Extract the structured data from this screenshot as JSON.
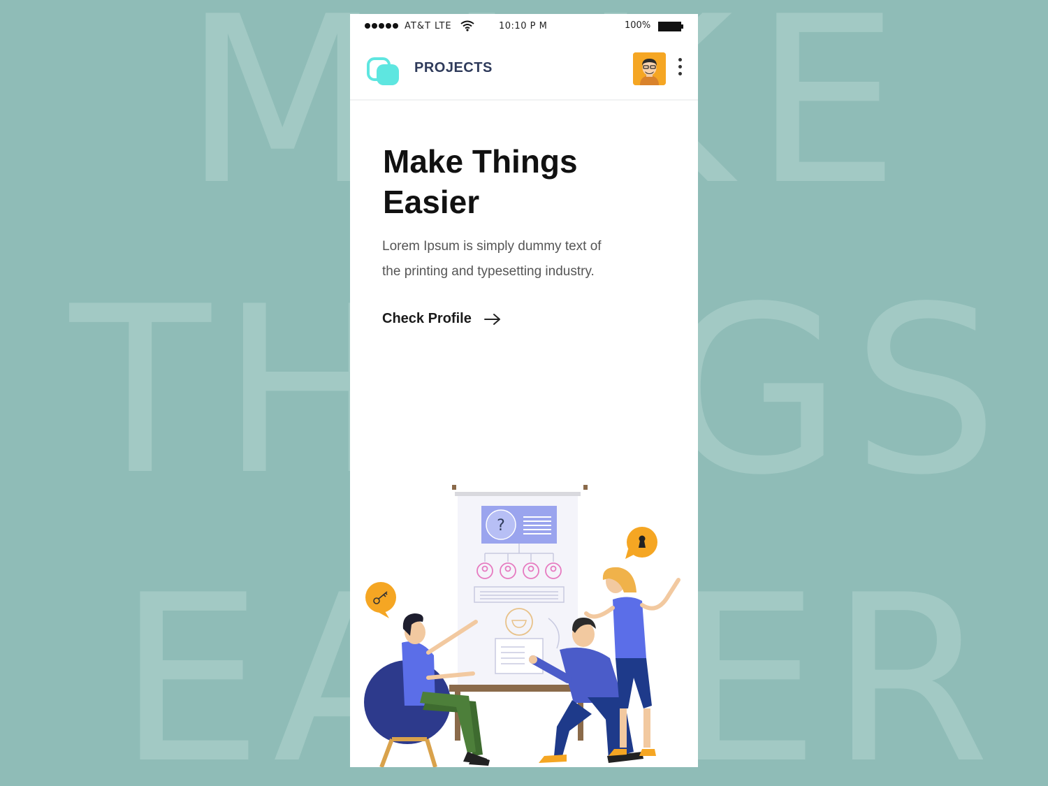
{
  "background": {
    "words": [
      "MAKE",
      "THINGS",
      "EASIER"
    ]
  },
  "status_bar": {
    "carrier": "AT&T  LTE",
    "time": "10:10 P    M",
    "battery": "100%"
  },
  "header": {
    "title": "PROJECTS"
  },
  "hero": {
    "title_line1": "Make Things",
    "title_line2": "Easier",
    "text_line1": "Lorem Ipsum is simply dummy text of",
    "text_line2": "the printing and typesetting industry.",
    "cta_label": "Check Profile"
  },
  "colors": {
    "background": "#8fbcb7",
    "accent_teal": "#5ee6e0",
    "accent_orange": "#f5a623",
    "accent_blue": "#5b6ee8",
    "text_dark": "#111111"
  },
  "icons": [
    "signal-dots-icon",
    "wifi-icon",
    "battery-icon",
    "logo-icon",
    "avatar",
    "kebab-menu-icon",
    "arrow-right-icon",
    "key-icon",
    "lock-icon"
  ]
}
